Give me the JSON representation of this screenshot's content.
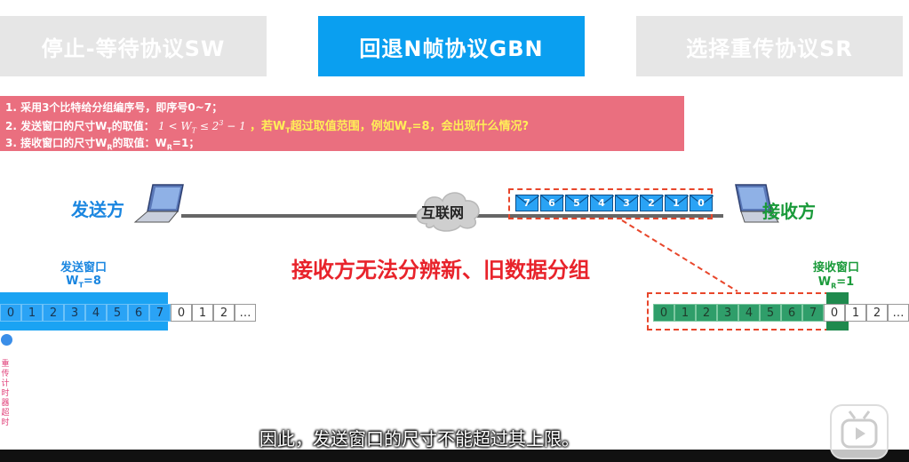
{
  "tabs": [
    {
      "label": "停止-等待协议SW"
    },
    {
      "label": "回退N帧协议GBN"
    },
    {
      "label": "选择重传协议SR"
    }
  ],
  "notes": {
    "line1": "1. 采用3个比特给分组编序号，即序号0~7；",
    "line2_prefix": "2. 发送窗口的尺寸W",
    "line2_sub": "T",
    "line2_mid": "的取值：",
    "line2_formula": "1 < W",
    "line2_formula_sub": "T",
    "line2_formula_rest": " ≤ 2",
    "line2_formula_sup": "3",
    "line2_formula_end": " − 1",
    "line2_question": "，若W",
    "line2_question_sub": "T",
    "line2_question_rest": "超过取值范围，例如W",
    "line2_question_sub2": "T",
    "line2_question_end": "=8，会出现什么情况?",
    "line3_prefix": "3. 接收窗口的尺寸W",
    "line3_sub": "R",
    "line3_rest": "的取值：W",
    "line3_sub2": "R",
    "line3_end": "=1；"
  },
  "sender": {
    "label": "发送方",
    "window_title": "发送窗口",
    "window_size_prefix": "W",
    "window_size_sub": "T",
    "window_size_val": "=8"
  },
  "receiver": {
    "label": "接收方",
    "window_title": "接收窗口",
    "window_size_prefix": "W",
    "window_size_sub": "R",
    "window_size_val": "=1"
  },
  "internet": {
    "label": "互联网"
  },
  "packets": [
    "7",
    "6",
    "5",
    "4",
    "3",
    "2",
    "1",
    "0"
  ],
  "warning": "接收方无法分辨新、旧数据分组",
  "sender_seq": [
    "0",
    "1",
    "2",
    "3",
    "4",
    "5",
    "6",
    "7",
    "0",
    "1",
    "2",
    "…"
  ],
  "receiver_seq": [
    "0",
    "1",
    "2",
    "3",
    "4",
    "5",
    "6",
    "7",
    "0",
    "1",
    "2",
    "…"
  ],
  "timer_text": "重传计时器超时",
  "subtitle": "因此，发送窗口的尺寸不能超过其上限。",
  "colors": {
    "tab_active": "#0a9ff0",
    "tab_inactive": "#e6e6e6",
    "notes_bg": "#ea6f7f",
    "warning": "#e8232b",
    "sender": "#1a86e0",
    "receiver": "#1a9a3a"
  }
}
